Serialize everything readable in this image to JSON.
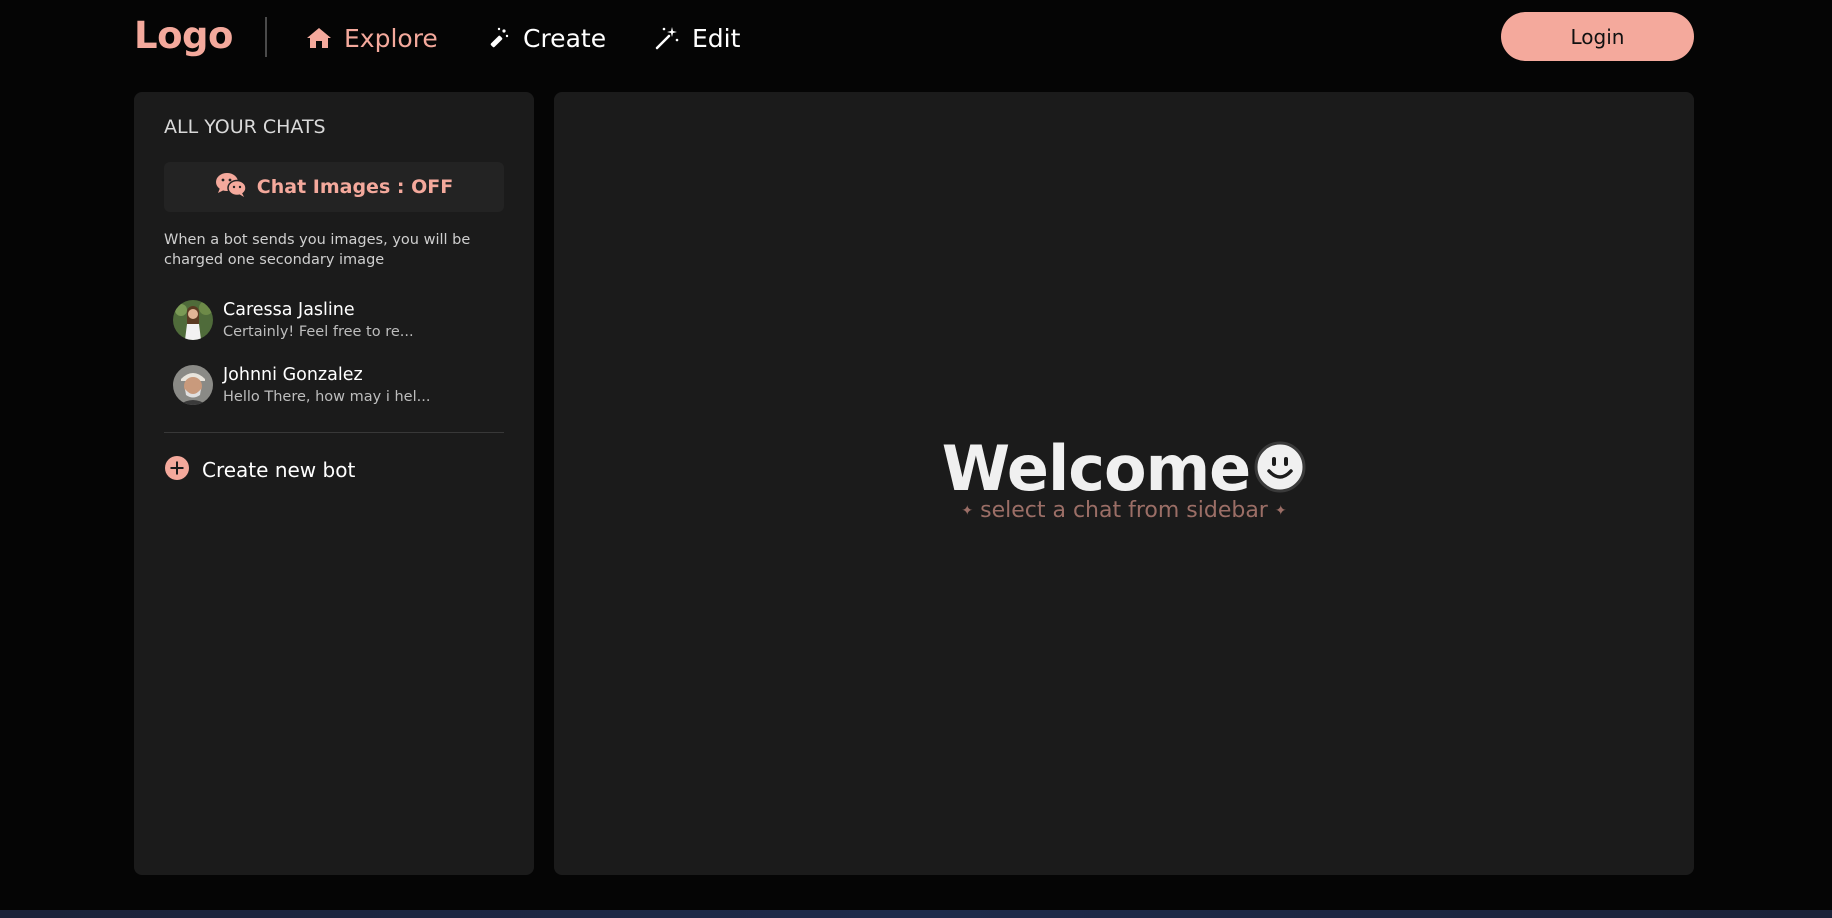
{
  "nav": {
    "logo": "Logo",
    "items": [
      {
        "label": "Explore",
        "icon": "home-icon",
        "active": true
      },
      {
        "label": "Create",
        "icon": "magic-wand-icon",
        "active": false
      },
      {
        "label": "Edit",
        "icon": "sparkle-wand-icon",
        "active": false
      }
    ],
    "login_label": "Login"
  },
  "sidebar": {
    "title": "ALL YOUR CHATS",
    "images_toggle_label": "Chat Images : OFF",
    "images_note": "When a bot sends you images, you will be charged one secondary image",
    "chats": [
      {
        "name": "Caressa Jasline",
        "preview": "Certainly! Feel free to re..."
      },
      {
        "name": "Johnni Gonzalez",
        "preview": "Hello There, how may i hel..."
      }
    ],
    "create_bot_label": "Create new bot"
  },
  "main": {
    "welcome_title": "Welcome",
    "welcome_subtitle": "select a chat from sidebar"
  },
  "colors": {
    "accent": "#f4a99c",
    "background": "#050505",
    "panel": "#1b1b1b",
    "subtitle": "#9b6e66"
  }
}
